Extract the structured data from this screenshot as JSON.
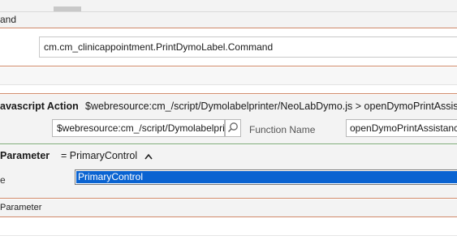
{
  "command_section": {
    "header_label": "and",
    "command_value": "cm.cm_clinicappointment.PrintDymoLabel.Command"
  },
  "javascript_action": {
    "title": "avascript Action",
    "description": "$webresource:cm_/script/Dymolabelprinter/NeoLabDymo.js > openDymoPrintAssis",
    "library_value": "$webresource:cm_/script/Dymolabelpri",
    "function_label": "Function Name",
    "function_value": "openDymoPrintAssistanc"
  },
  "parameter": {
    "title": "Parameter",
    "summary": "= PrimaryControl",
    "field_label": "e",
    "selected_option": "PrimaryControl"
  },
  "bottom": {
    "label": "Parameter"
  },
  "icons": {
    "search": "search-icon",
    "chevron": "chevron-up-icon"
  },
  "colors": {
    "selection": "#0a63d1",
    "section_border_orange": "#d08a6a",
    "section_border_green": "#7aa874"
  }
}
